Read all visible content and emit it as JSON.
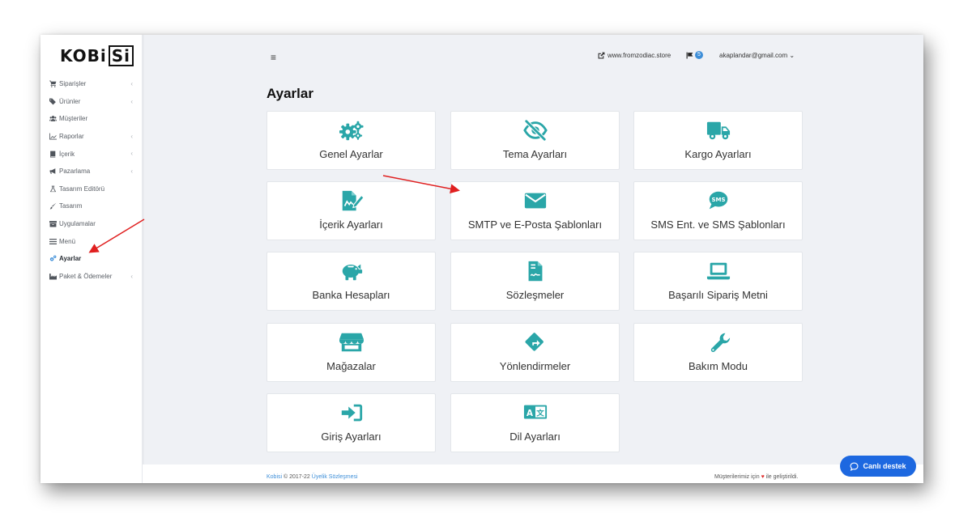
{
  "brand": {
    "logo_left": "KOBi",
    "logo_boxed": "Si"
  },
  "sidebar": {
    "items": [
      {
        "label": "Siparişler",
        "icon": "cart-icon",
        "chevron": "‹"
      },
      {
        "label": "Ürünler",
        "icon": "tags-icon",
        "chevron": "‹"
      },
      {
        "label": "Müşteriler",
        "icon": "users-icon",
        "chevron": ""
      },
      {
        "label": "Raporlar",
        "icon": "chart-icon",
        "chevron": "‹"
      },
      {
        "label": "İçerik",
        "icon": "book-icon",
        "chevron": "‹"
      },
      {
        "label": "Pazarlama",
        "icon": "megaphone-icon",
        "chevron": "‹"
      },
      {
        "label": "Tasarım Editörü",
        "icon": "flask-icon",
        "chevron": ""
      },
      {
        "label": "Tasarım",
        "icon": "brush-icon",
        "chevron": ""
      },
      {
        "label": "Uygulamalar",
        "icon": "archive-icon",
        "chevron": ""
      },
      {
        "label": "Menü",
        "icon": "bars-icon",
        "chevron": ""
      },
      {
        "label": "Ayarlar",
        "icon": "gears-icon",
        "chevron": "",
        "active": true
      },
      {
        "label": "Paket & Ödemeler",
        "icon": "industry-icon",
        "chevron": "‹"
      }
    ]
  },
  "header": {
    "menu_toggle": "≡",
    "site_link": "www.fromzodiac.store",
    "notifications_count": "5",
    "user_email": "akaplandar@gmail.com ⌄"
  },
  "page": {
    "title": "Ayarlar"
  },
  "settings_cards": [
    {
      "label": "Genel Ayarlar",
      "icon": "cogs-icon"
    },
    {
      "label": "Tema Ayarları",
      "icon": "eye-slash-icon"
    },
    {
      "label": "Kargo Ayarları",
      "icon": "truck-icon"
    },
    {
      "label": "İçerik Ayarları",
      "icon": "file-signature-icon"
    },
    {
      "label": "SMTP ve E-Posta Şablonları",
      "icon": "envelope-icon"
    },
    {
      "label": "SMS Ent. ve SMS Şablonları",
      "icon": "sms-icon"
    },
    {
      "label": "Banka Hesapları",
      "icon": "piggy-bank-icon"
    },
    {
      "label": "Sözleşmeler",
      "icon": "file-contract-icon"
    },
    {
      "label": "Başarılı Sipariş Metni",
      "icon": "laptop-icon"
    },
    {
      "label": "Mağazalar",
      "icon": "store-icon"
    },
    {
      "label": "Yönlendirmeler",
      "icon": "directions-icon"
    },
    {
      "label": "Bakım Modu",
      "icon": "wrench-icon"
    },
    {
      "label": "Giriş Ayarları",
      "icon": "sign-in-icon"
    },
    {
      "label": "Dil Ayarları",
      "icon": "language-icon"
    }
  ],
  "footer": {
    "brand_link": "Kobisi",
    "copyright": " © 2017-22 ",
    "terms_link": "Üyelik Sözleşmesi",
    "right_prefix": "Müşterilerimiz için ",
    "heart": "♥",
    "right_suffix": " ile geliştirildi."
  },
  "chat": {
    "label": "Canlı destek"
  },
  "colors": {
    "accent": "#2aa6a8",
    "primary": "#1d68e0",
    "annotation_arrow": "#e02020"
  }
}
